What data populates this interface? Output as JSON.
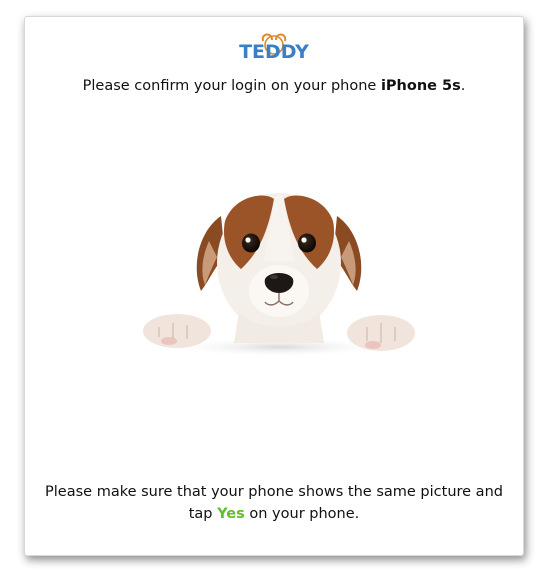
{
  "app": {
    "logo_text": "TEDDY"
  },
  "colors": {
    "logo_blue": "#3a7fc6",
    "logo_ear": "#e08a2c",
    "accent_green": "#5fbf2a"
  },
  "confirm": {
    "prefix": "Please confirm your login on your phone ",
    "device_name": "iPhone 5s",
    "suffix": "."
  },
  "picture": {
    "icon": "puppy-picture"
  },
  "instructions": {
    "line": "Please make sure that your phone shows the same picture and tap ",
    "yes_word": "Yes",
    "tail": " on your phone."
  }
}
